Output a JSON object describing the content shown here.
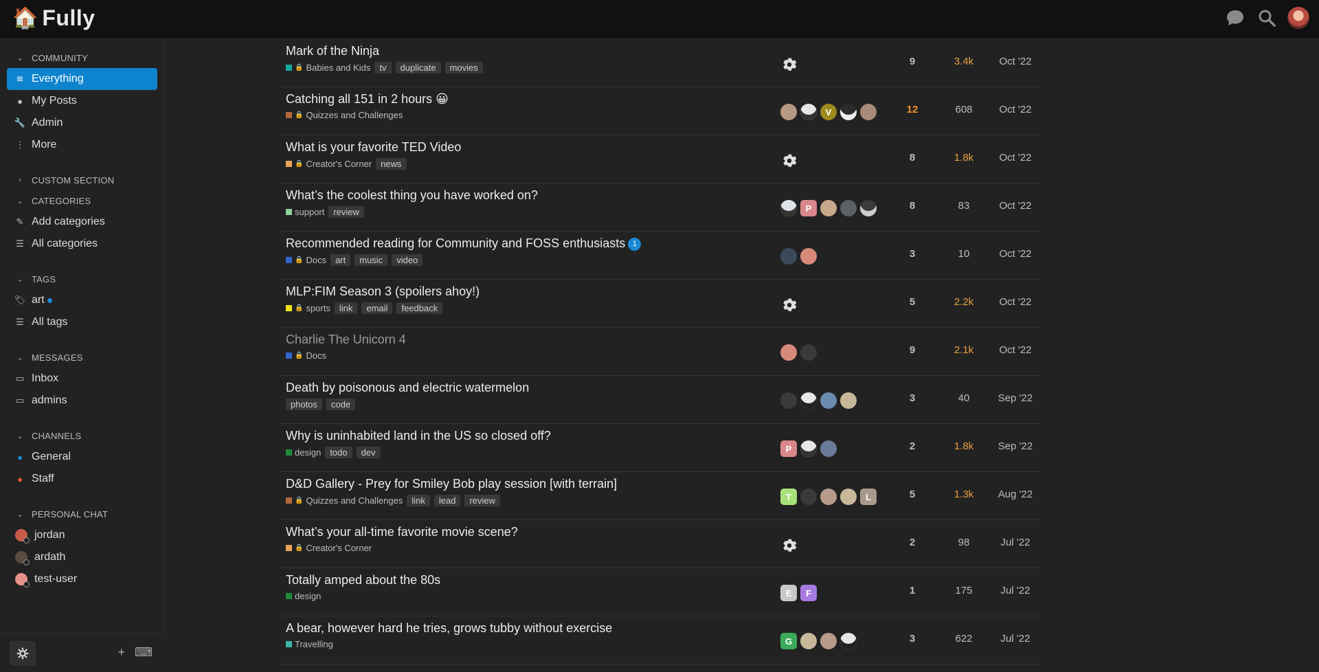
{
  "app": {
    "name": "Fully"
  },
  "sidebar": {
    "community_label": "COMMUNITY",
    "community": [
      {
        "label": "Everything",
        "icon": "layers-icon",
        "active": true
      },
      {
        "label": "My Posts",
        "icon": "user-icon"
      },
      {
        "label": "Admin",
        "icon": "wrench-icon"
      },
      {
        "label": "More",
        "icon": "more-vertical-icon"
      }
    ],
    "custom_label": "CUSTOM SECTION",
    "categories_label": "CATEGORIES",
    "categories": [
      {
        "label": "Add categories",
        "icon": "pencil-icon"
      },
      {
        "label": "All categories",
        "icon": "list-icon"
      }
    ],
    "tags_label": "TAGS",
    "tags": [
      {
        "label": "art",
        "icon": "tag-icon"
      },
      {
        "label": "All tags",
        "icon": "list-icon"
      }
    ],
    "messages_label": "MESSAGES",
    "messages": [
      {
        "label": "Inbox",
        "icon": "inbox-icon"
      },
      {
        "label": "admins",
        "icon": "inbox-icon"
      }
    ],
    "channels_label": "CHANNELS",
    "channels": [
      {
        "label": "General",
        "icon": "chat-bubble-icon",
        "color": "#1a8ad4"
      },
      {
        "label": "Staff",
        "icon": "chat-bubble-lock-icon",
        "color": "#e45735"
      }
    ],
    "personal_label": "PERSONAL CHAT",
    "personal": [
      {
        "label": "jordan"
      },
      {
        "label": "ardath"
      },
      {
        "label": "test-user"
      }
    ]
  },
  "topics": [
    {
      "title": "Mark of the Ninja",
      "category": "Babies and Kids",
      "cat_color": "#12a89d",
      "locked": true,
      "tags": [
        "tv",
        "duplicate",
        "movies"
      ],
      "posters": "gear",
      "replies": "9",
      "views": "3.4k",
      "views_hot": true,
      "activity": "Oct '22"
    },
    {
      "title": "Catching all 151 in 2 hours 😀",
      "category": "Quizzes and Challenges",
      "cat_color": "#b3673d",
      "locked": true,
      "tags": [],
      "posters": "five",
      "replies": "12",
      "replies_hot": true,
      "views": "608",
      "activity": "Oct '22"
    },
    {
      "title": "What is your favorite TED Video",
      "category": "Creator's Corner",
      "cat_color": "#e9a35a",
      "locked": true,
      "tags": [
        "news"
      ],
      "posters": "gear",
      "replies": "8",
      "views": "1.8k",
      "views_hot": true,
      "activity": "Oct '22"
    },
    {
      "title": "What’s the coolest thing you have worked on?",
      "category": "support",
      "cat_color": "#8ed19a",
      "locked": false,
      "tags": [
        "review"
      ],
      "posters": "five2",
      "replies": "8",
      "views": "83",
      "activity": "Oct '22"
    },
    {
      "title": "Recommended reading for Community and FOSS enthusiasts",
      "badge": "1",
      "category": "Docs",
      "cat_color": "#3366cc",
      "locked": true,
      "tags": [
        "art",
        "music",
        "video"
      ],
      "posters": "two",
      "replies": "3",
      "views": "10",
      "activity": "Oct '22"
    },
    {
      "title": "MLP:FIM Season 3 (spoilers ahoy!)",
      "category": "sports",
      "cat_color": "#f1e218",
      "locked": true,
      "tags": [
        "link",
        "email",
        "feedback"
      ],
      "posters": "gear",
      "replies": "5",
      "views": "2.2k",
      "views_hot": true,
      "activity": "Oct '22"
    },
    {
      "title": "Charlie The Unicorn 4",
      "read": true,
      "category": "Docs",
      "cat_color": "#3366cc",
      "locked": true,
      "tags": [],
      "posters": "two2",
      "replies": "9",
      "views": "2.1k",
      "views_hot": true,
      "activity": "Oct '22"
    },
    {
      "title": "Death by poisonous and electric watermelon",
      "category": "",
      "tags": [
        "photos",
        "code"
      ],
      "posters": "four",
      "replies": "3",
      "views": "40",
      "activity": "Sep '22"
    },
    {
      "title": "Why is uninhabited land in the US so closed off?",
      "category": "design",
      "cat_color": "#1f8a3a",
      "locked": false,
      "tags": [
        "todo",
        "dev"
      ],
      "posters": "three",
      "replies": "2",
      "views": "1.8k",
      "views_hot": true,
      "activity": "Sep '22"
    },
    {
      "title": "D&D Gallery - Prey for Smiley Bob play session [with terrain]",
      "category": "Quizzes and Challenges",
      "cat_color": "#b3673d",
      "locked": true,
      "tags": [
        "link",
        "lead",
        "review"
      ],
      "posters": "five3",
      "replies": "5",
      "views": "1.3k",
      "views_hot": true,
      "activity": "Aug '22"
    },
    {
      "title": "What’s your all-time favorite movie scene?",
      "category": "Creator's Corner",
      "cat_color": "#e9a35a",
      "locked": true,
      "tags": [],
      "posters": "gear",
      "replies": "2",
      "views": "98",
      "activity": "Jul '22"
    },
    {
      "title": "Totally amped about the 80s",
      "category": "design",
      "cat_color": "#1f8a3a",
      "locked": false,
      "tags": [],
      "posters": "ef",
      "replies": "1",
      "views": "175",
      "activity": "Jul '22"
    },
    {
      "title": "A bear, however hard he tries, grows tubby without exercise",
      "category": "Travelling",
      "cat_color": "#3ab5a6",
      "locked": false,
      "tags": [],
      "posters": "g4",
      "replies": "3",
      "views": "622",
      "activity": "Jul '22"
    }
  ]
}
